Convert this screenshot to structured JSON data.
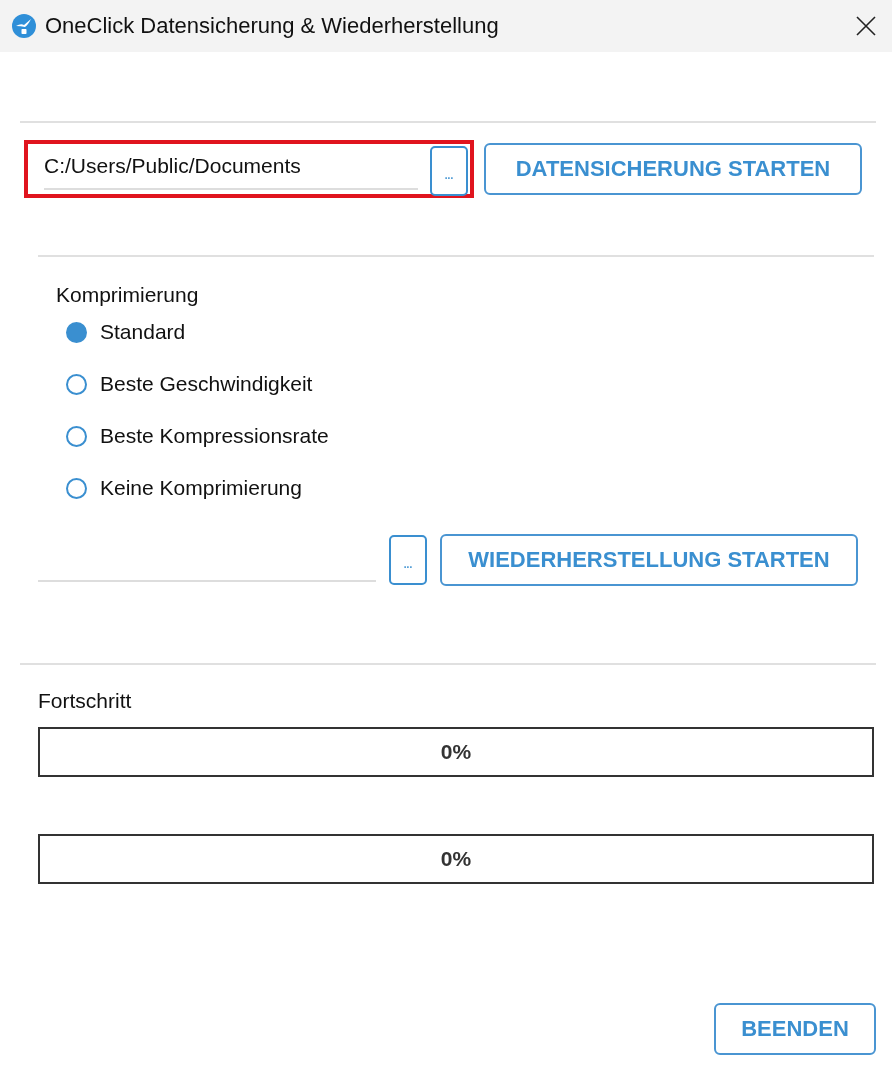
{
  "window": {
    "title": "OneClick Datensicherung & Wiederherstellung"
  },
  "backup": {
    "path": "C:/Users/Public/Documents",
    "highlighted": true,
    "browse_label": "...",
    "button": "DATENSICHERUNG STARTEN"
  },
  "compression": {
    "label": "Komprimierung",
    "options": [
      {
        "label": "Standard",
        "selected": true
      },
      {
        "label": "Beste Geschwindigkeit",
        "selected": false
      },
      {
        "label": "Beste Kompressionsrate",
        "selected": false
      },
      {
        "label": "Keine Komprimierung",
        "selected": false
      }
    ]
  },
  "restore": {
    "browse_label": "...",
    "button": "WIEDERHERSTELLUNG STARTEN"
  },
  "progress": {
    "label": "Fortschritt",
    "bars": [
      {
        "level": 0,
        "reading": "0%"
      },
      {
        "level": 0,
        "reading": "0%"
      }
    ]
  },
  "buttons": [
    "BEENDEN"
  ]
}
